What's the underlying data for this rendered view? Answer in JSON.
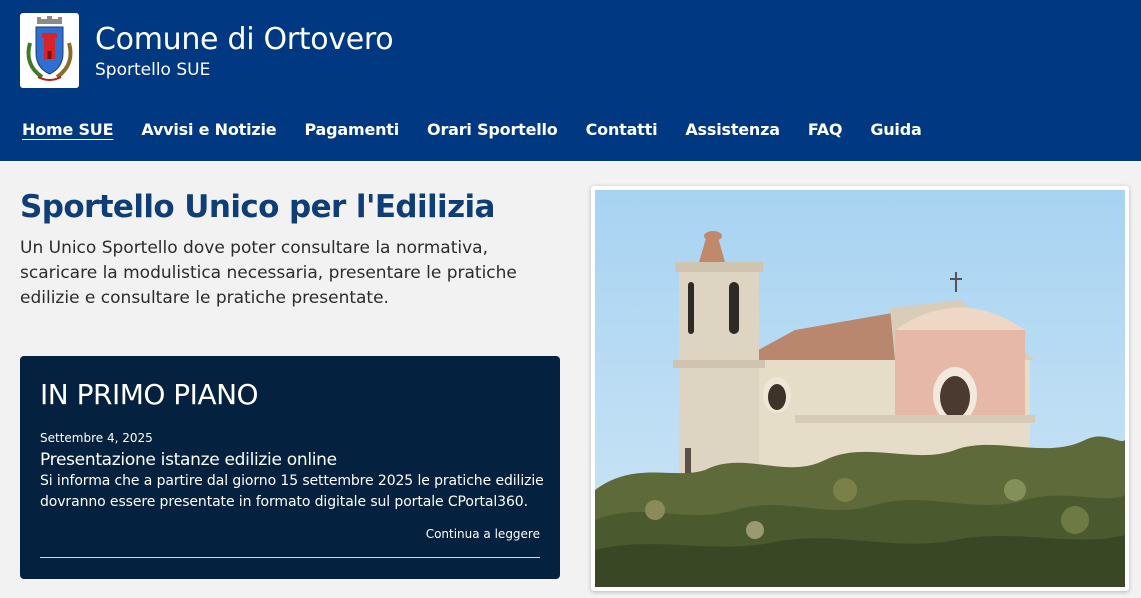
{
  "header": {
    "title": "Comune di Ortovero",
    "subtitle": "Sportello SUE",
    "logo_icon": "municipal-coat-of-arms",
    "background_color": "#003882"
  },
  "nav": {
    "items": [
      {
        "label": "Home SUE",
        "active": true
      },
      {
        "label": "Avvisi e Notizie",
        "active": false
      },
      {
        "label": "Pagamenti",
        "active": false
      },
      {
        "label": "Orari Sportello",
        "active": false
      },
      {
        "label": "Contatti",
        "active": false
      },
      {
        "label": "Assistenza",
        "active": false
      },
      {
        "label": "FAQ",
        "active": false
      },
      {
        "label": "Guida",
        "active": false
      }
    ]
  },
  "hero": {
    "title": "Sportello Unico per l'Edilizia",
    "description": "Un Unico Sportello dove poter consultare la normativa, scaricare la modulistica necessaria, presentare le pratiche edilizie e consultare le pratiche presentate."
  },
  "featured": {
    "heading": "IN PRIMO PIANO",
    "date": "Settembre 4, 2025",
    "title": "Presentazione istanze edilizie online",
    "text": "Si informa che a partire dal giorno 15 settembre 2025 le pratiche edilizie dovranno essere presentate in formato digitale sul portale CPortal360.",
    "more_link": "Continua a leggere",
    "background_color": "#04223f"
  },
  "photo": {
    "subject": "church-on-hill-photo"
  }
}
